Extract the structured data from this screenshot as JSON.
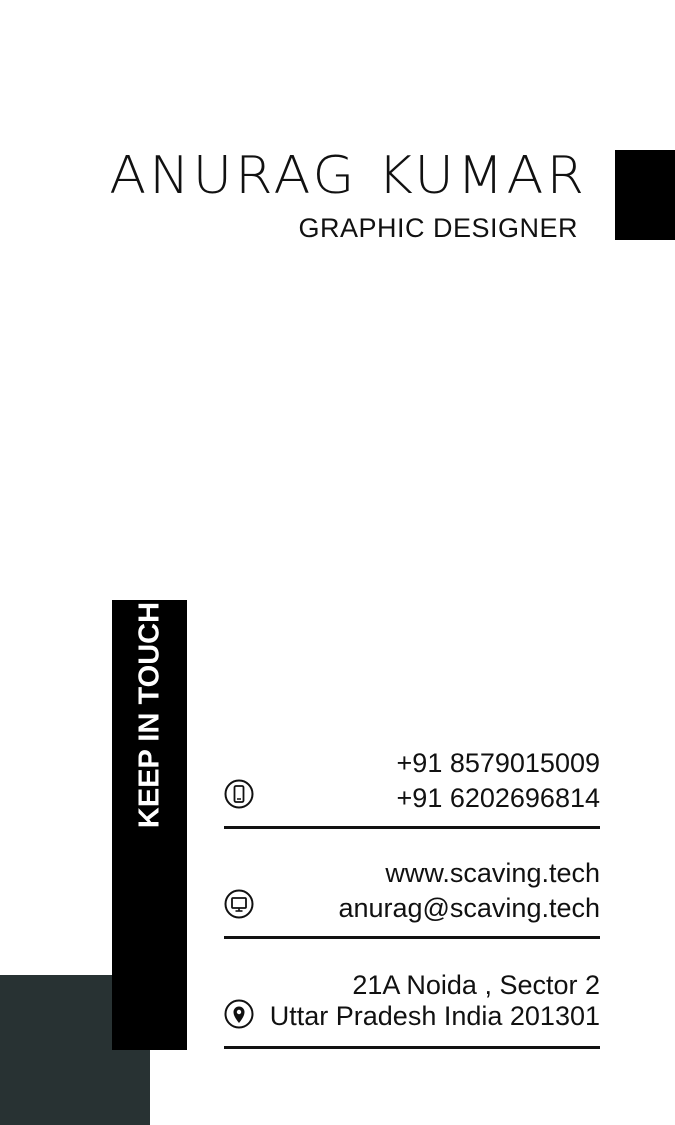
{
  "card": {
    "name": "ANURAG KUMAR",
    "title": "GRAPHIC DESIGNER",
    "sidebar_label": "KEEP IN TOUCH"
  },
  "contact": {
    "phone": {
      "icon": "mobile-phone-icon",
      "line1": "+91 8579015009",
      "line2": "+91 6202696814"
    },
    "web": {
      "icon": "monitor-icon",
      "line1": "www.scaving.tech",
      "line2": "anurag@scaving.tech"
    },
    "address": {
      "icon": "map-pin-icon",
      "line1": "21A Noida , Sector 2",
      "line2": "Uttar Pradesh India 201301"
    }
  },
  "colors": {
    "background": "#ffffff",
    "accent_black": "#000000",
    "dark_slate": "#283233",
    "text": "#111111"
  }
}
